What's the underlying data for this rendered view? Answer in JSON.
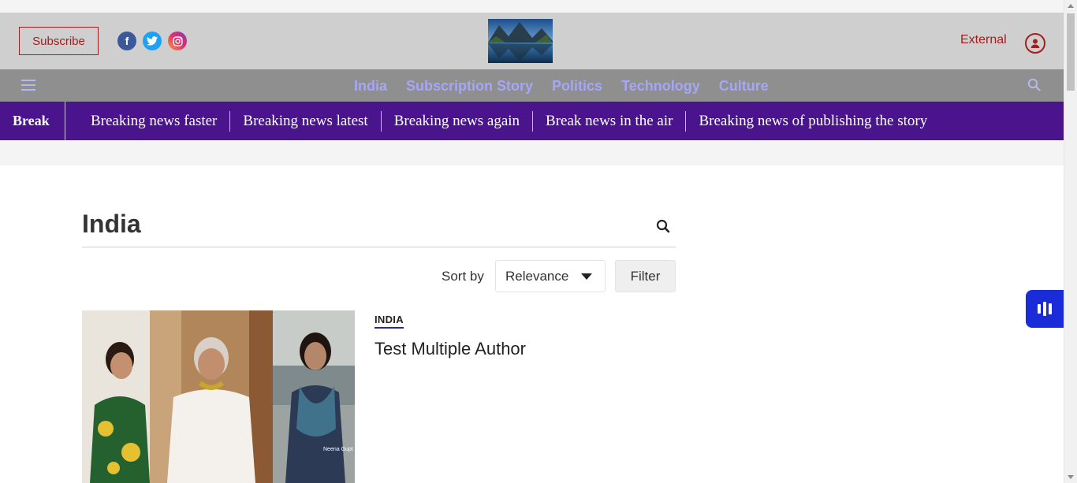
{
  "header": {
    "subscribe_label": "Subscribe",
    "social": [
      {
        "name": "facebook-icon",
        "glyph": "f"
      },
      {
        "name": "twitter-icon",
        "glyph": "t"
      },
      {
        "name": "instagram-icon",
        "glyph": "◎"
      }
    ],
    "external_label": "External"
  },
  "nav": {
    "links": [
      "India",
      "Subscription Story",
      "Politics",
      "Technology",
      "Culture"
    ]
  },
  "breaking": {
    "label": "Break",
    "items": [
      "Breaking news faster",
      "Breaking news latest",
      "Breaking news again",
      "Break news in the air",
      "Breaking news of publishing the story"
    ]
  },
  "main": {
    "title": "India",
    "sort_label": "Sort by",
    "sort_value": "Relevance",
    "filter_label": "Filter",
    "story": {
      "section": "INDIA",
      "title": "Test Multiple Author",
      "image_caption": "Neena Gupt"
    }
  },
  "colors": {
    "accent": "#a31d1d",
    "nav_link": "#a6a6f7",
    "breaking_bg": "#4a148c",
    "float_button": "#1a2bd8"
  }
}
